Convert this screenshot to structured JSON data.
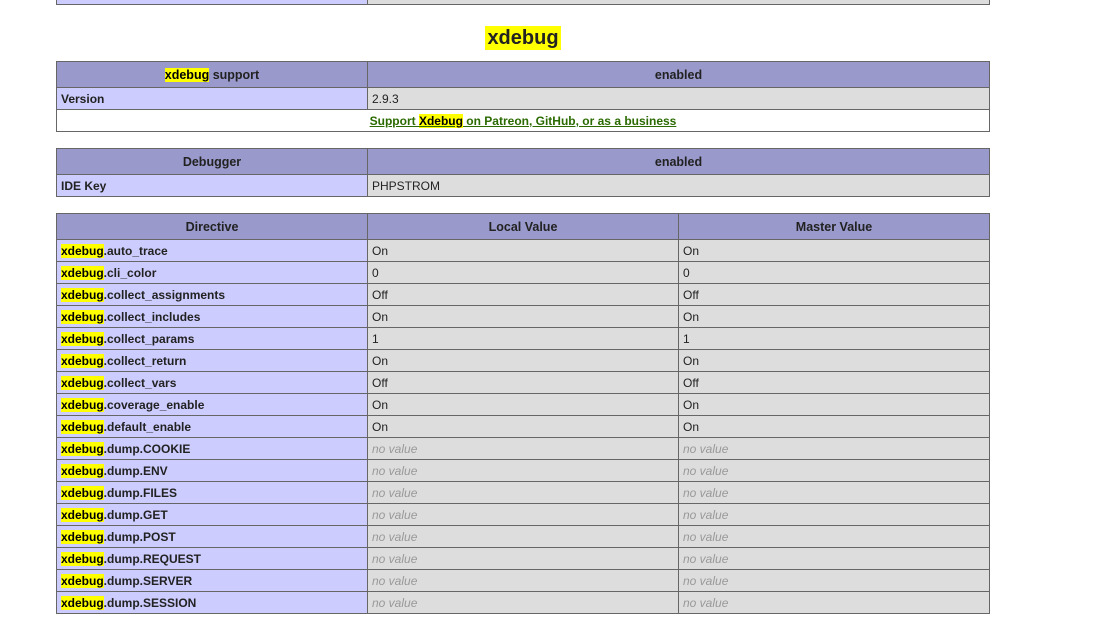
{
  "module_title": "xdebug",
  "highlight": "xdebug",
  "support_table": {
    "header_suffix": " support",
    "header_value": "enabled",
    "rows": [
      {
        "name": "Version",
        "value": "2.9.3"
      }
    ],
    "support_link": {
      "prefix": "Support ",
      "highlight": "Xdebug",
      "suffix": " on Patreon, GitHub, or as a business"
    }
  },
  "debugger_table": {
    "header_name": "Debugger",
    "header_value": "enabled",
    "rows": [
      {
        "name": "IDE Key",
        "value": "PHPSTROM"
      }
    ]
  },
  "directives_table": {
    "headers": [
      "Directive",
      "Local Value",
      "Master Value"
    ],
    "rows": [
      {
        "name": ".auto_trace",
        "local": "On",
        "master": "On"
      },
      {
        "name": ".cli_color",
        "local": "0",
        "master": "0"
      },
      {
        "name": ".collect_assignments",
        "local": "Off",
        "master": "Off"
      },
      {
        "name": ".collect_includes",
        "local": "On",
        "master": "On"
      },
      {
        "name": ".collect_params",
        "local": "1",
        "master": "1"
      },
      {
        "name": ".collect_return",
        "local": "On",
        "master": "On"
      },
      {
        "name": ".collect_vars",
        "local": "Off",
        "master": "Off"
      },
      {
        "name": ".coverage_enable",
        "local": "On",
        "master": "On"
      },
      {
        "name": ".default_enable",
        "local": "On",
        "master": "On"
      },
      {
        "name": ".dump.COOKIE",
        "local": "no value",
        "master": "no value"
      },
      {
        "name": ".dump.ENV",
        "local": "no value",
        "master": "no value"
      },
      {
        "name": ".dump.FILES",
        "local": "no value",
        "master": "no value"
      },
      {
        "name": ".dump.GET",
        "local": "no value",
        "master": "no value"
      },
      {
        "name": ".dump.POST",
        "local": "no value",
        "master": "no value"
      },
      {
        "name": ".dump.REQUEST",
        "local": "no value",
        "master": "no value"
      },
      {
        "name": ".dump.SERVER",
        "local": "no value",
        "master": "no value"
      },
      {
        "name": ".dump.SESSION",
        "local": "no value",
        "master": "no value"
      }
    ]
  },
  "colors": {
    "header_bg": "#9999cc",
    "name_bg": "#ccccff",
    "value_bg": "#dddddd",
    "highlight": "#ffff00",
    "link": "#2a6a00"
  }
}
